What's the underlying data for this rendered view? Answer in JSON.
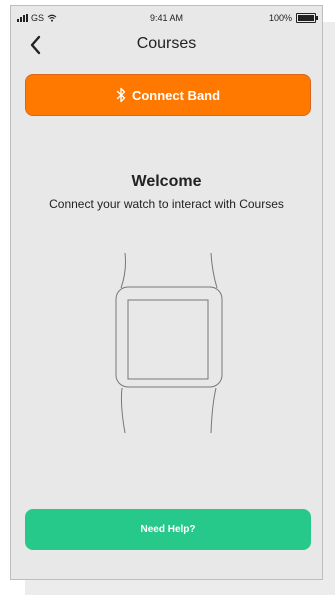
{
  "status_bar": {
    "carrier": "GS",
    "time": "9:41 AM",
    "battery": "100%"
  },
  "header": {
    "title": "Courses",
    "back_icon": "chevron-left-icon"
  },
  "connect_button": {
    "label": "Connect Band",
    "icon": "bluetooth-icon",
    "color": "#ff7800"
  },
  "welcome": {
    "title": "Welcome",
    "subtitle": "Connect your watch to interact with Courses"
  },
  "illustration": {
    "icon": "smartwatch-outline"
  },
  "help_button": {
    "label": "Need Help?",
    "color": "#27c98a"
  }
}
